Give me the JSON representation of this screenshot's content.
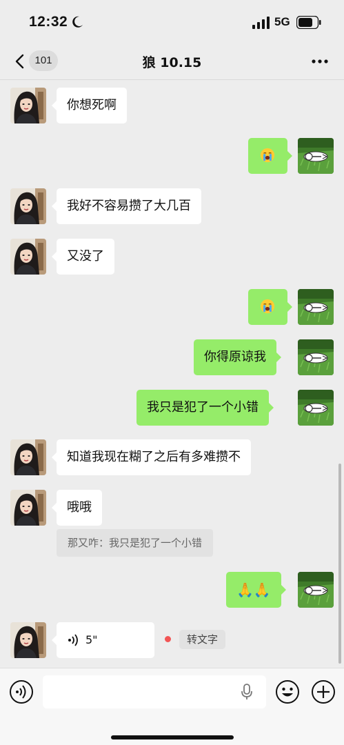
{
  "status_bar": {
    "time": "12:32",
    "network": "5G",
    "icons": [
      "moon-icon",
      "signal-icon",
      "battery-icon"
    ]
  },
  "nav": {
    "unread_count": "101",
    "title": "狼 10.15",
    "more_icon": "more-dots-icon"
  },
  "messages": [
    {
      "side": "in",
      "text": "你想死啊"
    },
    {
      "side": "out",
      "text": "😭"
    },
    {
      "side": "in",
      "text": "我好不容易攒了大几百"
    },
    {
      "side": "in",
      "text": "又没了"
    },
    {
      "side": "out",
      "text": "😭"
    },
    {
      "side": "out",
      "text": "你得原谅我"
    },
    {
      "side": "out",
      "text": "我只是犯了一个小错"
    },
    {
      "side": "in",
      "text": "知道我现在糊了之后有多难攒不"
    },
    {
      "side": "in",
      "text": "哦哦"
    },
    {
      "side": "out",
      "text": "🙏🙏"
    },
    {
      "side": "in",
      "text": "5\""
    }
  ],
  "quote": {
    "text": "那又咋：我只是犯了一个小错"
  },
  "voice_message": {
    "duration": "5\"",
    "to_text_label": "转文字",
    "unread": true
  },
  "input_bar": {
    "placeholder": "",
    "icons": [
      "voice-toggle-icon",
      "mic-icon",
      "emoji-icon",
      "plus-icon"
    ]
  },
  "colors": {
    "background": "#ededed",
    "outgoing_bubble": "#95ec69",
    "incoming_bubble": "#ffffff",
    "unread_dot": "#f25555"
  }
}
